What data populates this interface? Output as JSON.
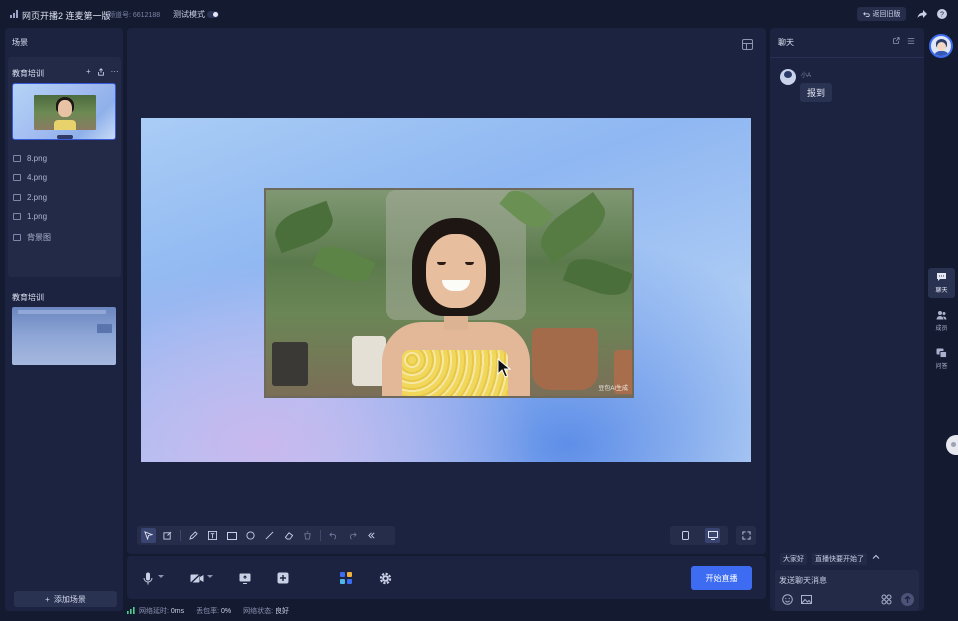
{
  "topbar": {
    "title": "网页开播2 连麦第一版",
    "channel": "频道号: 6612188",
    "test_mode_label": "测试模式",
    "test_mode_on": true,
    "back_label": "返回旧版"
  },
  "left_panel": {
    "header": "场景",
    "group1": {
      "name": "教育培训",
      "assets": [
        "8.png",
        "4.png",
        "2.png",
        "1.png",
        "背景图"
      ]
    },
    "group2": {
      "name": "教育培训"
    },
    "add_scene_label": "添加场景"
  },
  "stage": {
    "watermark": "豆包AI生成"
  },
  "controls": {
    "start_label": "开始直播"
  },
  "status": {
    "latency_label": "网络延时:",
    "latency_value": "0ms",
    "loss_label": "丢包率:",
    "loss_value": "0%",
    "net_label": "网络状态:",
    "net_value": "良好"
  },
  "chat": {
    "header": "聊天",
    "messages": [
      {
        "user": "小A",
        "text": "报到"
      }
    ],
    "quick_replies": [
      "大家好",
      "直播快要开始了"
    ],
    "input_placeholder": "发送聊天消息"
  },
  "rail": {
    "items": [
      {
        "label": "聊天",
        "icon": "chat-icon",
        "active": true
      },
      {
        "label": "成员",
        "icon": "members-icon",
        "active": false
      },
      {
        "label": "问答",
        "icon": "qa-icon",
        "active": false
      }
    ]
  },
  "colors": {
    "background": "#141a30",
    "panel": "#1c2340",
    "accent": "#3d6cf2"
  }
}
